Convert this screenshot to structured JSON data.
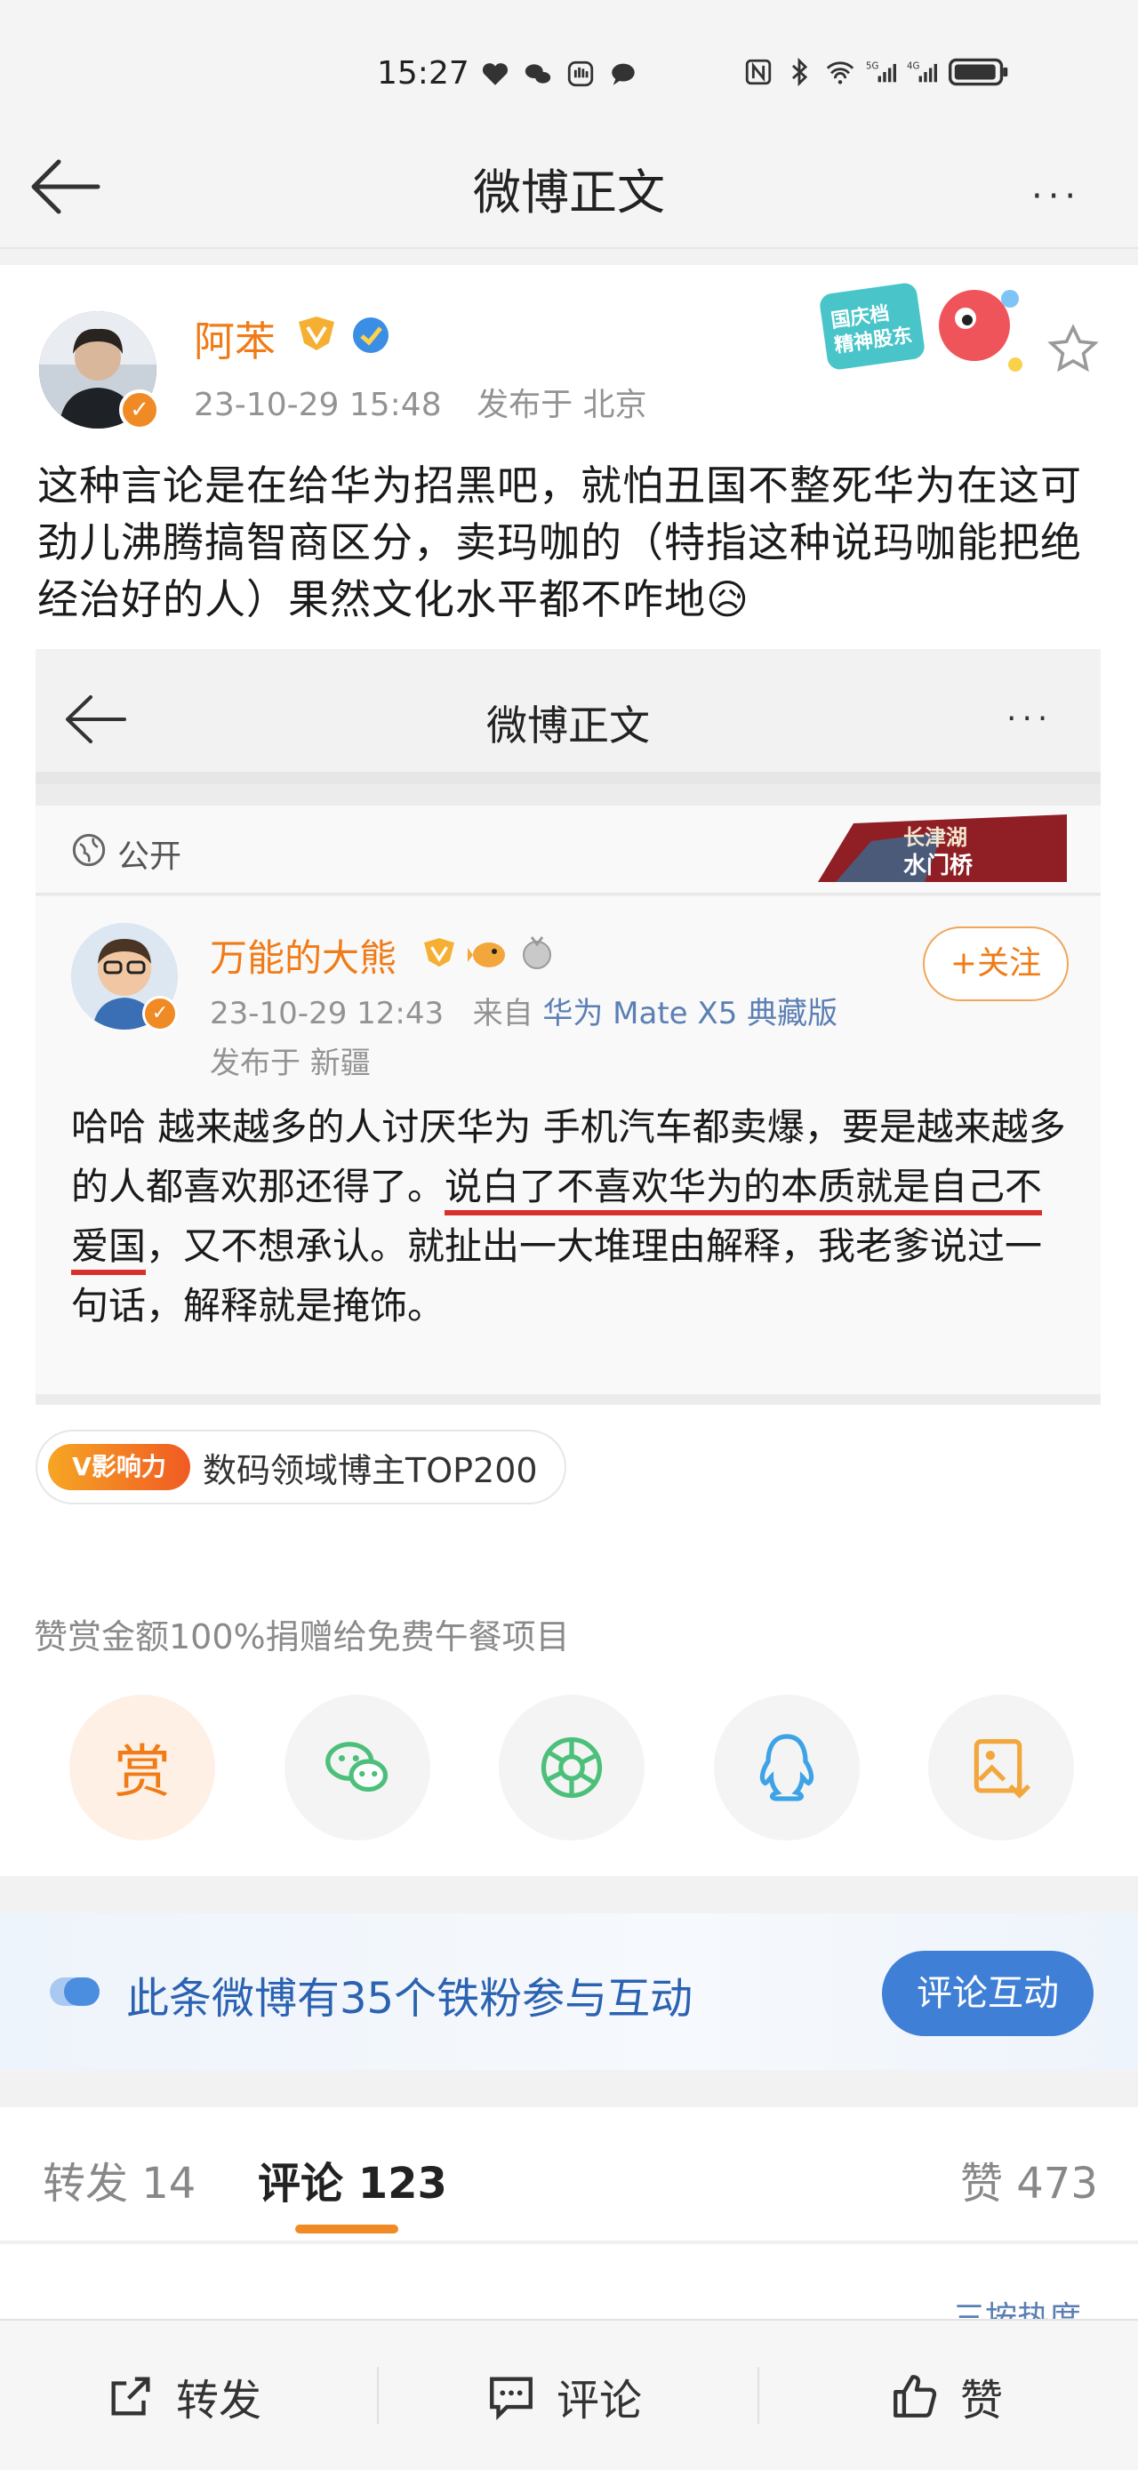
{
  "status_bar": {
    "time": "15:27",
    "left_icons": [
      "heart-icon",
      "wechat-icon",
      "hand-icon",
      "chat-bubble-icon"
    ],
    "right_icons": [
      "nfc-icon",
      "bluetooth-icon",
      "wifi-icon",
      "signal-5g-icon",
      "signal-4g-icon",
      "battery-icon"
    ]
  },
  "nav": {
    "title": "微博正文",
    "back_icon": "back-arrow-icon",
    "more_label": "···"
  },
  "post": {
    "author": "阿苯",
    "author_icons": [
      "gold-badge-icon",
      "blue-verified-icon"
    ],
    "date": "23-10-29 15:48",
    "location": "发布于 北京",
    "promo_badge_text": "国庆档精神股东",
    "text": "这种言论是在给华为招黑吧，就怕丑国不整死华为在这可劲儿沸腾搞智商区分，卖玛咖的（特指这种说玛咖能把绝经治好的人）果然文化水平都不咋地😥"
  },
  "embedded": {
    "nav_title": "微博正文",
    "more_label": "···",
    "visibility": "公开",
    "banner_text": "长津湖水门桥",
    "author": "万能的大熊",
    "date": "23-10-29 12:43",
    "source_prefix": "来自",
    "device": "华为 Mate X5 典藏版",
    "location": "发布于 新疆",
    "follow_label": "+关注",
    "text_a": "哈哈 越来越多的人讨厌华为 手机汽车都卖爆，要是越来越多的人都喜欢那还得了。",
    "text_underlined": "说白了不喜欢华为的本质就是自己不爱国",
    "text_b": "，又不想承认。就扯出一大堆理由解释，我老爹说过一句话，解释就是掩饰。"
  },
  "influence": {
    "badge": "V影响力",
    "text": "数码领域博主TOP200"
  },
  "reward": {
    "caption": "赞赏金额100%捐赠给免费午餐项目",
    "reward_char": "赏",
    "share_icons": [
      "reward-icon",
      "wechat-icon",
      "moments-icon",
      "qq-icon",
      "save-image-icon"
    ]
  },
  "fans": {
    "text": "此条微博有35个铁粉参与互动",
    "button": "评论互动"
  },
  "tabs": {
    "repost": "转发 14",
    "comment": "评论 123",
    "like": "赞 473",
    "sort_peek": "三按热度"
  },
  "bottom_bar": {
    "repost": "转发",
    "comment": "评论",
    "like": "赞"
  },
  "colors": {
    "accent_orange": "#f07b17",
    "link_blue": "#2b62b1",
    "button_blue": "#3f7fd6",
    "underline_red": "#d8312c"
  }
}
